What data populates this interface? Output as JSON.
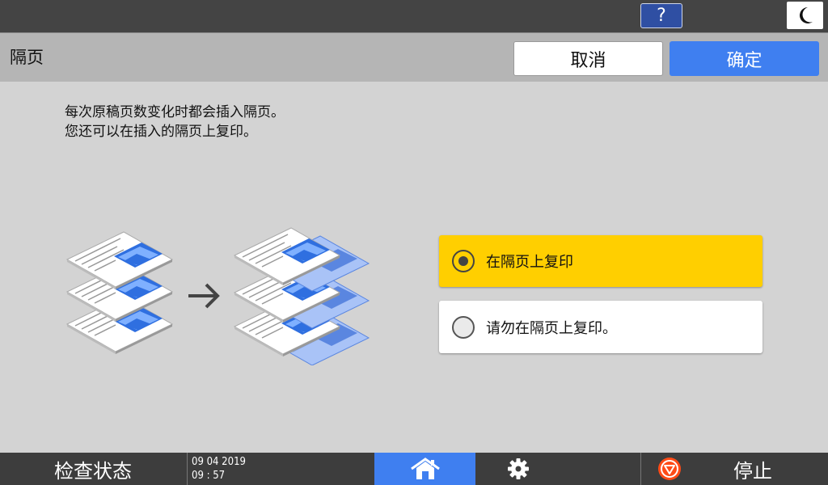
{
  "topbar": {
    "help_label": "?"
  },
  "header": {
    "title": "隔页",
    "cancel_label": "取消",
    "ok_label": "确定"
  },
  "description": {
    "line1": "每次原稿页数变化时都会插入隔页。",
    "line2": "您还可以在插入的隔页上复印。"
  },
  "options": [
    {
      "label": "在隔页上复印",
      "selected": true
    },
    {
      "label": "请勿在隔页上复印。",
      "selected": false
    }
  ],
  "bottombar": {
    "status_label": "检查状态",
    "date": "09 04 2019",
    "time": "09 : 57",
    "stop_label": "停止"
  },
  "colors": {
    "accent": "#3f7ff0",
    "selected": "#ffcf00",
    "stop_icon": "#ff4b17"
  }
}
